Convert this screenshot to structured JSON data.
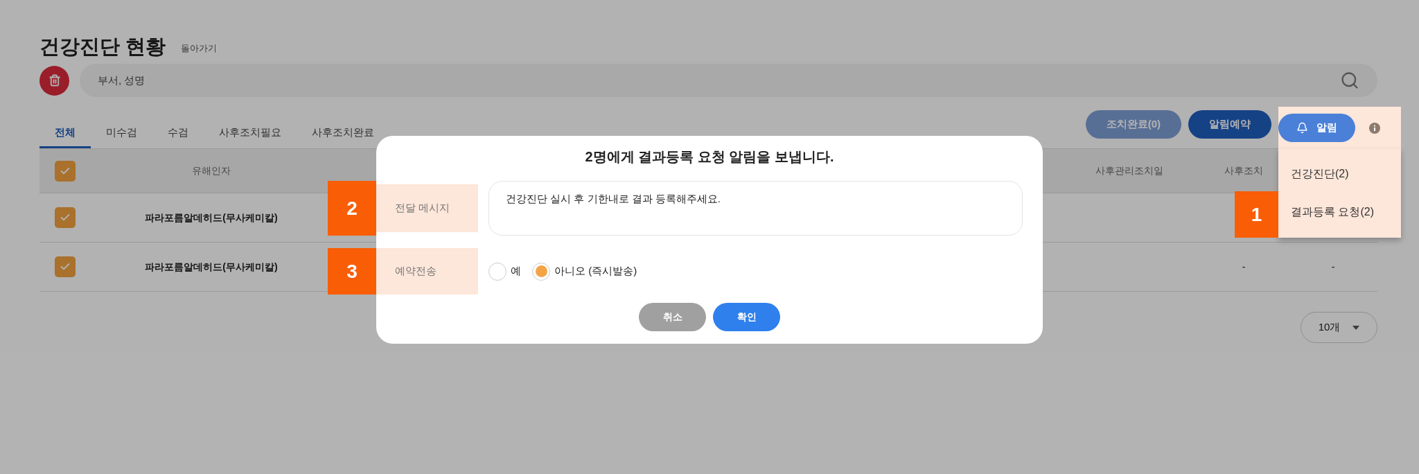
{
  "page": {
    "title": "건강진단 현황",
    "back_link": "돌아가기"
  },
  "search": {
    "placeholder": "부서, 성명"
  },
  "tabs": [
    {
      "label": "전체",
      "selected": true
    },
    {
      "label": "미수검",
      "selected": false
    },
    {
      "label": "수검",
      "selected": false
    },
    {
      "label": "사후조치필요",
      "selected": false
    },
    {
      "label": "사후조치완료",
      "selected": false
    }
  ],
  "toolbar": {
    "buttons": [
      {
        "label": "조치완료(0)",
        "kind": "faded"
      },
      {
        "label": "알림예약",
        "kind": "dark"
      }
    ],
    "notify_button": {
      "label": "알림"
    }
  },
  "notify_menu": {
    "marker": "1",
    "items": [
      "건강진단(2)",
      "결과등록 요청(2)"
    ]
  },
  "table": {
    "select_all_checked": true,
    "columns": [
      "유해인자",
      "사후관리조치일",
      "사후조치"
    ],
    "rows": [
      {
        "checked": true,
        "hazard": "파라포름알데히드(무사케미칼)"
      },
      {
        "checked": true,
        "hazard": "파라포름알데히드(무사케미칼)",
        "follow_up": "-",
        "column_6": "-"
      }
    ]
  },
  "page_size": "10개",
  "dialog": {
    "title": "2명에게 결과등록 요청 알림을 보냅니다.",
    "fields": [
      {
        "label": "전달 메시지",
        "marker": "2",
        "kind": "text",
        "value": "건강진단 실시 후 기한내로 결과 등록해주세요."
      },
      {
        "label": "예약전송",
        "marker": "3",
        "kind": "radio",
        "options": [
          {
            "label": "예",
            "selected": false
          },
          {
            "label": "아니오 (즉시발송)",
            "selected": true
          }
        ]
      }
    ],
    "buttons": [
      {
        "label": "취소",
        "kind": "cancel"
      },
      {
        "label": "확인",
        "kind": "confirm"
      }
    ]
  }
}
